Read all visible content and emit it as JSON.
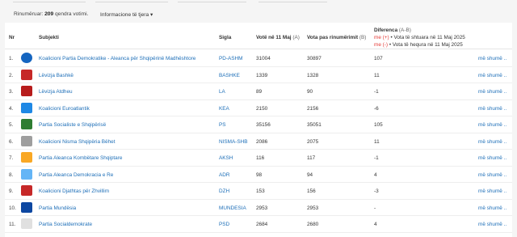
{
  "summary": {
    "prefix": "Rinumëruar:",
    "count": "209",
    "suffix": "qendra votimi."
  },
  "info_dropdown": "Informacione të tjera",
  "headers": {
    "nr": "Nr",
    "subjekti": "Subjekti",
    "sigla": "Sigla",
    "votes_may": "Votë në 11 Maj",
    "votes_may_tag": "(A)",
    "votes_recount": "Vota pas rinumërimit",
    "votes_recount_tag": "(B)",
    "diff": "Diferenca",
    "diff_tag": "(A-B)",
    "legend_plus_sign": "me (+)",
    "legend_plus_text": "• Vota të shtuara në 11 Maj 2025",
    "legend_minus_sign": "me (-)",
    "legend_minus_text": "• Vota të hequra në 11 Maj 2025"
  },
  "more_label": "më shumë ..",
  "colors": {
    "link": "#1e6fb8",
    "legend_red": "#e53935"
  },
  "rows": [
    {
      "nr": "1.",
      "name": "Koalicioni Partia Demokratike - Aleanca për Shqipërinë Madhështore",
      "sigla": "PD-ASHM",
      "votes_a": "31004",
      "votes_b": "30897",
      "diff": "107",
      "logo_color": "#1565c0",
      "logo_icon": "pd-logo-icon",
      "logo_round": true
    },
    {
      "nr": "2.",
      "name": "Lëvizja Bashkë",
      "sigla": "BASHKE",
      "votes_a": "1339",
      "votes_b": "1328",
      "diff": "11",
      "logo_color": "#c62828",
      "logo_icon": "bashke-logo-icon",
      "logo_round": false
    },
    {
      "nr": "3.",
      "name": "Lëvizja Atdheu",
      "sigla": "LA",
      "votes_a": "89",
      "votes_b": "90",
      "diff": "-1",
      "logo_color": "#b71c1c",
      "logo_icon": "atdheu-logo-icon",
      "logo_round": false
    },
    {
      "nr": "4.",
      "name": "Koalicioni Euroatlantik",
      "sigla": "KEA",
      "votes_a": "2150",
      "votes_b": "2156",
      "diff": "-6",
      "logo_color": "#1e88e5",
      "logo_icon": "kea-logo-icon",
      "logo_round": false
    },
    {
      "nr": "5.",
      "name": "Partia Socialiste e Shqipërisë",
      "sigla": "PS",
      "votes_a": "35156",
      "votes_b": "35051",
      "diff": "105",
      "logo_color": "#2e7d32",
      "logo_icon": "ps-logo-icon",
      "logo_round": false
    },
    {
      "nr": "6.",
      "name": "Koalicioni Nisma Shqipëria Bëhet",
      "sigla": "NISMA-SHB",
      "votes_a": "2086",
      "votes_b": "2075",
      "diff": "11",
      "logo_color": "#9e9e9e",
      "logo_icon": "nisma-logo-icon",
      "logo_round": false
    },
    {
      "nr": "7.",
      "name": "Partia Aleanca Kombëtare Shqiptare",
      "sigla": "AKSH",
      "votes_a": "116",
      "votes_b": "117",
      "diff": "-1",
      "logo_color": "#f9a825",
      "logo_icon": "aksh-logo-icon",
      "logo_round": false
    },
    {
      "nr": "8.",
      "name": "Partia Aleanca Demokracia e Re",
      "sigla": "ADR",
      "votes_a": "98",
      "votes_b": "94",
      "diff": "4",
      "logo_color": "#64b5f6",
      "logo_icon": "adr-logo-icon",
      "logo_round": false
    },
    {
      "nr": "9.",
      "name": "Koalicioni Djathtas për Zhvillim",
      "sigla": "DZH",
      "votes_a": "153",
      "votes_b": "156",
      "diff": "-3",
      "logo_color": "#c62828",
      "logo_icon": "dzh-logo-icon",
      "logo_round": false
    },
    {
      "nr": "10.",
      "name": "Partia Mundësia",
      "sigla": "MUNDESIA",
      "votes_a": "2953",
      "votes_b": "2953",
      "diff": "-",
      "logo_color": "#0d47a1",
      "logo_icon": "mundesia-logo-icon",
      "logo_round": false
    },
    {
      "nr": "11.",
      "name": "Partia Socialdemokrate",
      "sigla": "PSD",
      "votes_a": "2684",
      "votes_b": "2680",
      "diff": "4",
      "logo_color": "#e0e0e0",
      "logo_icon": "psd-logo-icon",
      "logo_round": false
    }
  ]
}
